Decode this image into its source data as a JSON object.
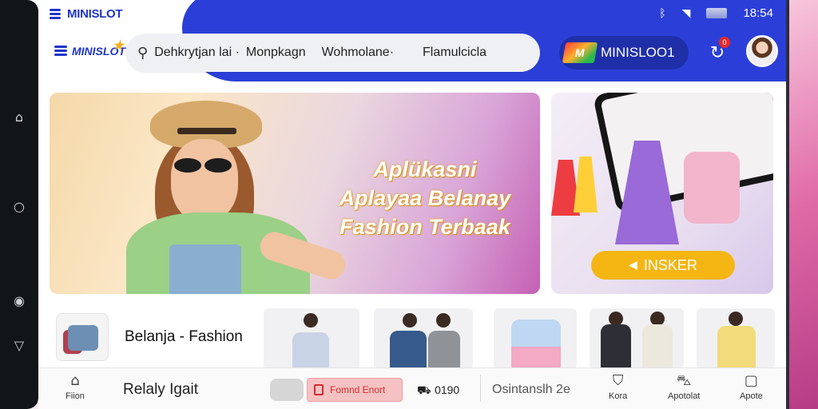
{
  "status_bar": {
    "brand": "MINISLOT",
    "time": "18:54",
    "icons": [
      "bluetooth-icon",
      "wifi-icon",
      "battery-icon"
    ]
  },
  "app_bar": {
    "logo": "MINISLOT",
    "search_tags": [
      "Dehkrytjan lai ·",
      "Monpkagn",
      "Wohmolane·",
      "Flamulcicla"
    ],
    "brand_pill": "MINISLOO1",
    "notification_count": "0"
  },
  "banner": {
    "lines": [
      "Aplükasni",
      "Aplayaa Belanay",
      "Fashion Terbaak"
    ]
  },
  "promo": {
    "button": "INSKER"
  },
  "category": {
    "label": "Belanja - Fashion"
  },
  "bottom_nav": {
    "items": [
      {
        "icon": "home-icon",
        "label": "Fiion"
      },
      {
        "icon": "shirt-icon",
        "label": "Kora"
      },
      {
        "icon": "cart-icon",
        "label": "Apotolat"
      },
      {
        "icon": "bag-icon",
        "label": "Apote"
      }
    ],
    "text_left": "Relaly Igait",
    "red_button": "Fomnd Enort",
    "ship_label": "0190",
    "text_right": "Osintanslh 2e"
  },
  "colors": {
    "primary_blue": "#2b3fd8",
    "accent_yellow": "#f5b614",
    "accent_red": "#e52a2a"
  }
}
